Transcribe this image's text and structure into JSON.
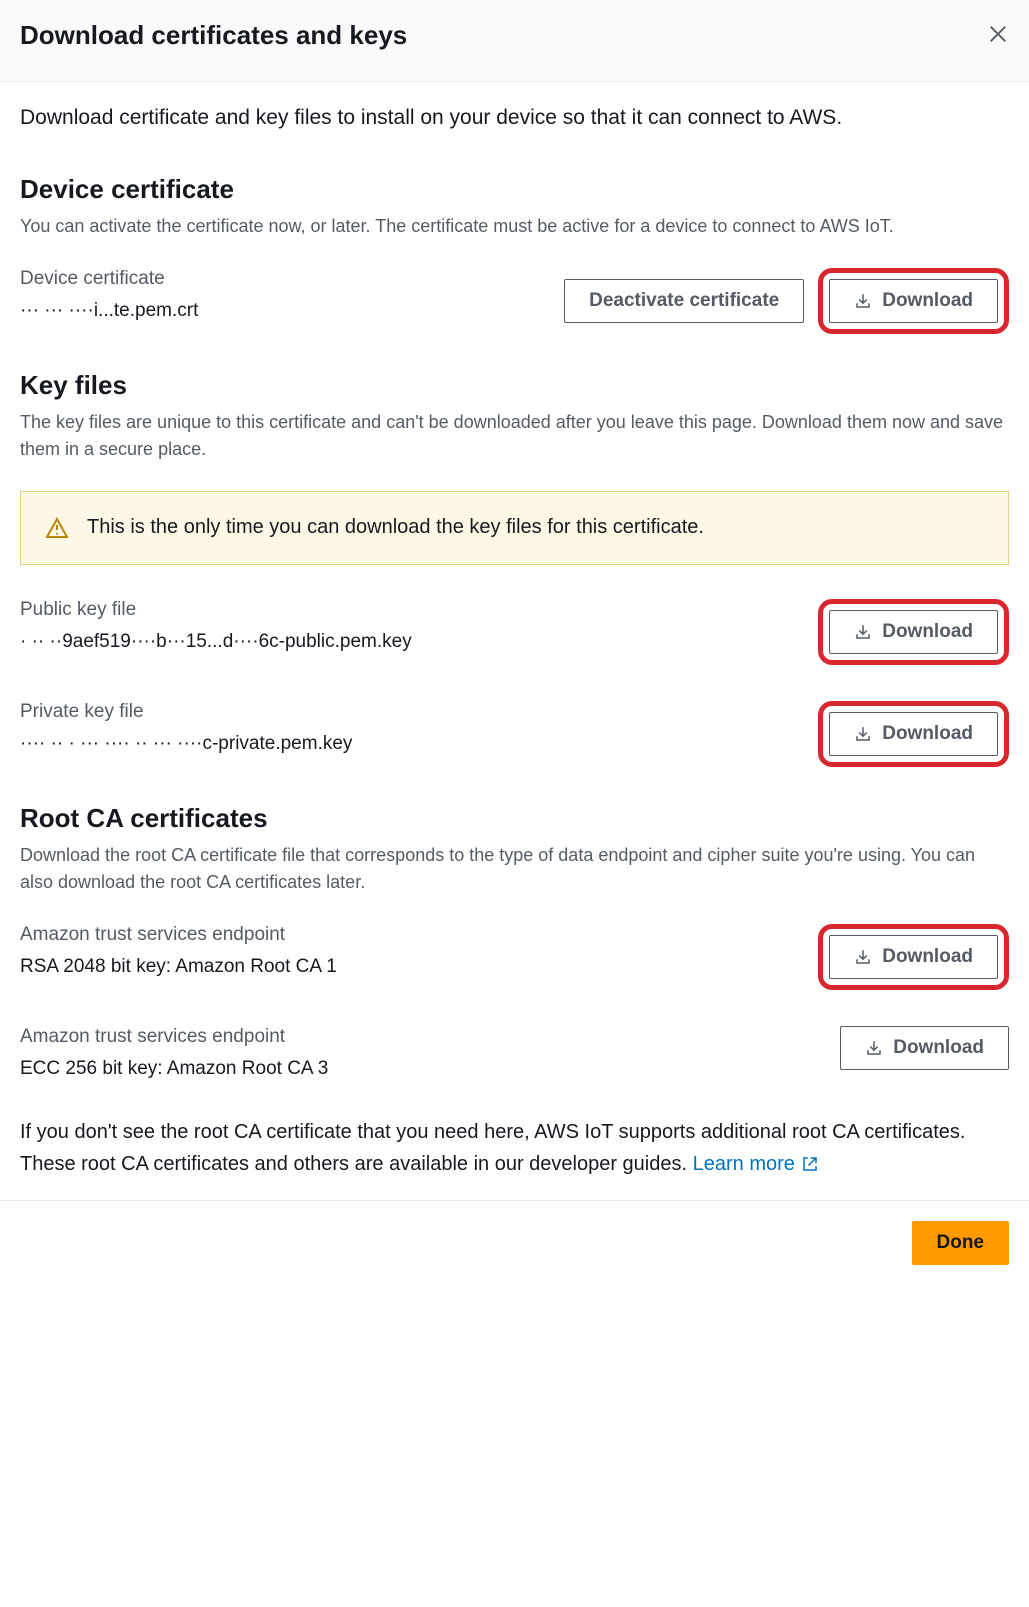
{
  "header": {
    "title": "Download certificates and keys"
  },
  "intro": "Download certificate and key files to install on your device so that it can connect to AWS.",
  "device_cert": {
    "title": "Device certificate",
    "desc": "You can activate the certificate now, or later. The certificate must be active for a device to connect to AWS IoT.",
    "label": "Device certificate",
    "filename": "··· ··· ····i...te.pem.crt",
    "deactivate_label": "Deactivate certificate",
    "download_label": "Download"
  },
  "key_files": {
    "title": "Key files",
    "desc": "The key files are unique to this certificate and can't be downloaded after you leave this page. Download them now and save them in a secure place.",
    "alert": "This is the only time you can download the key files for this certificate.",
    "public_label": "Public key file",
    "public_filename": "· ·· ··9aef519····b···15...d····6c-public.pem.key",
    "public_download": "Download",
    "private_label": "Private key file",
    "private_filename": "···· ·· · ··· ···· ·· ··· ····c-private.pem.key",
    "private_download": "Download"
  },
  "root_ca": {
    "title": "Root CA certificates",
    "desc": "Download the root CA certificate file that corresponds to the type of data endpoint and cipher suite you're using. You can also download the root CA certificates later.",
    "rsa_label": "Amazon trust services endpoint",
    "rsa_value": "RSA 2048 bit key: Amazon Root CA 1",
    "rsa_download": "Download",
    "ecc_label": "Amazon trust services endpoint",
    "ecc_value": "ECC 256 bit key: Amazon Root CA 3",
    "ecc_download": "Download",
    "footer_text": "If you don't see the root CA certificate that you need here, AWS IoT supports additional root CA certificates. These root CA certificates and others are available in our developer guides. ",
    "learn_more": "Learn more"
  },
  "footer": {
    "done": "Done"
  }
}
